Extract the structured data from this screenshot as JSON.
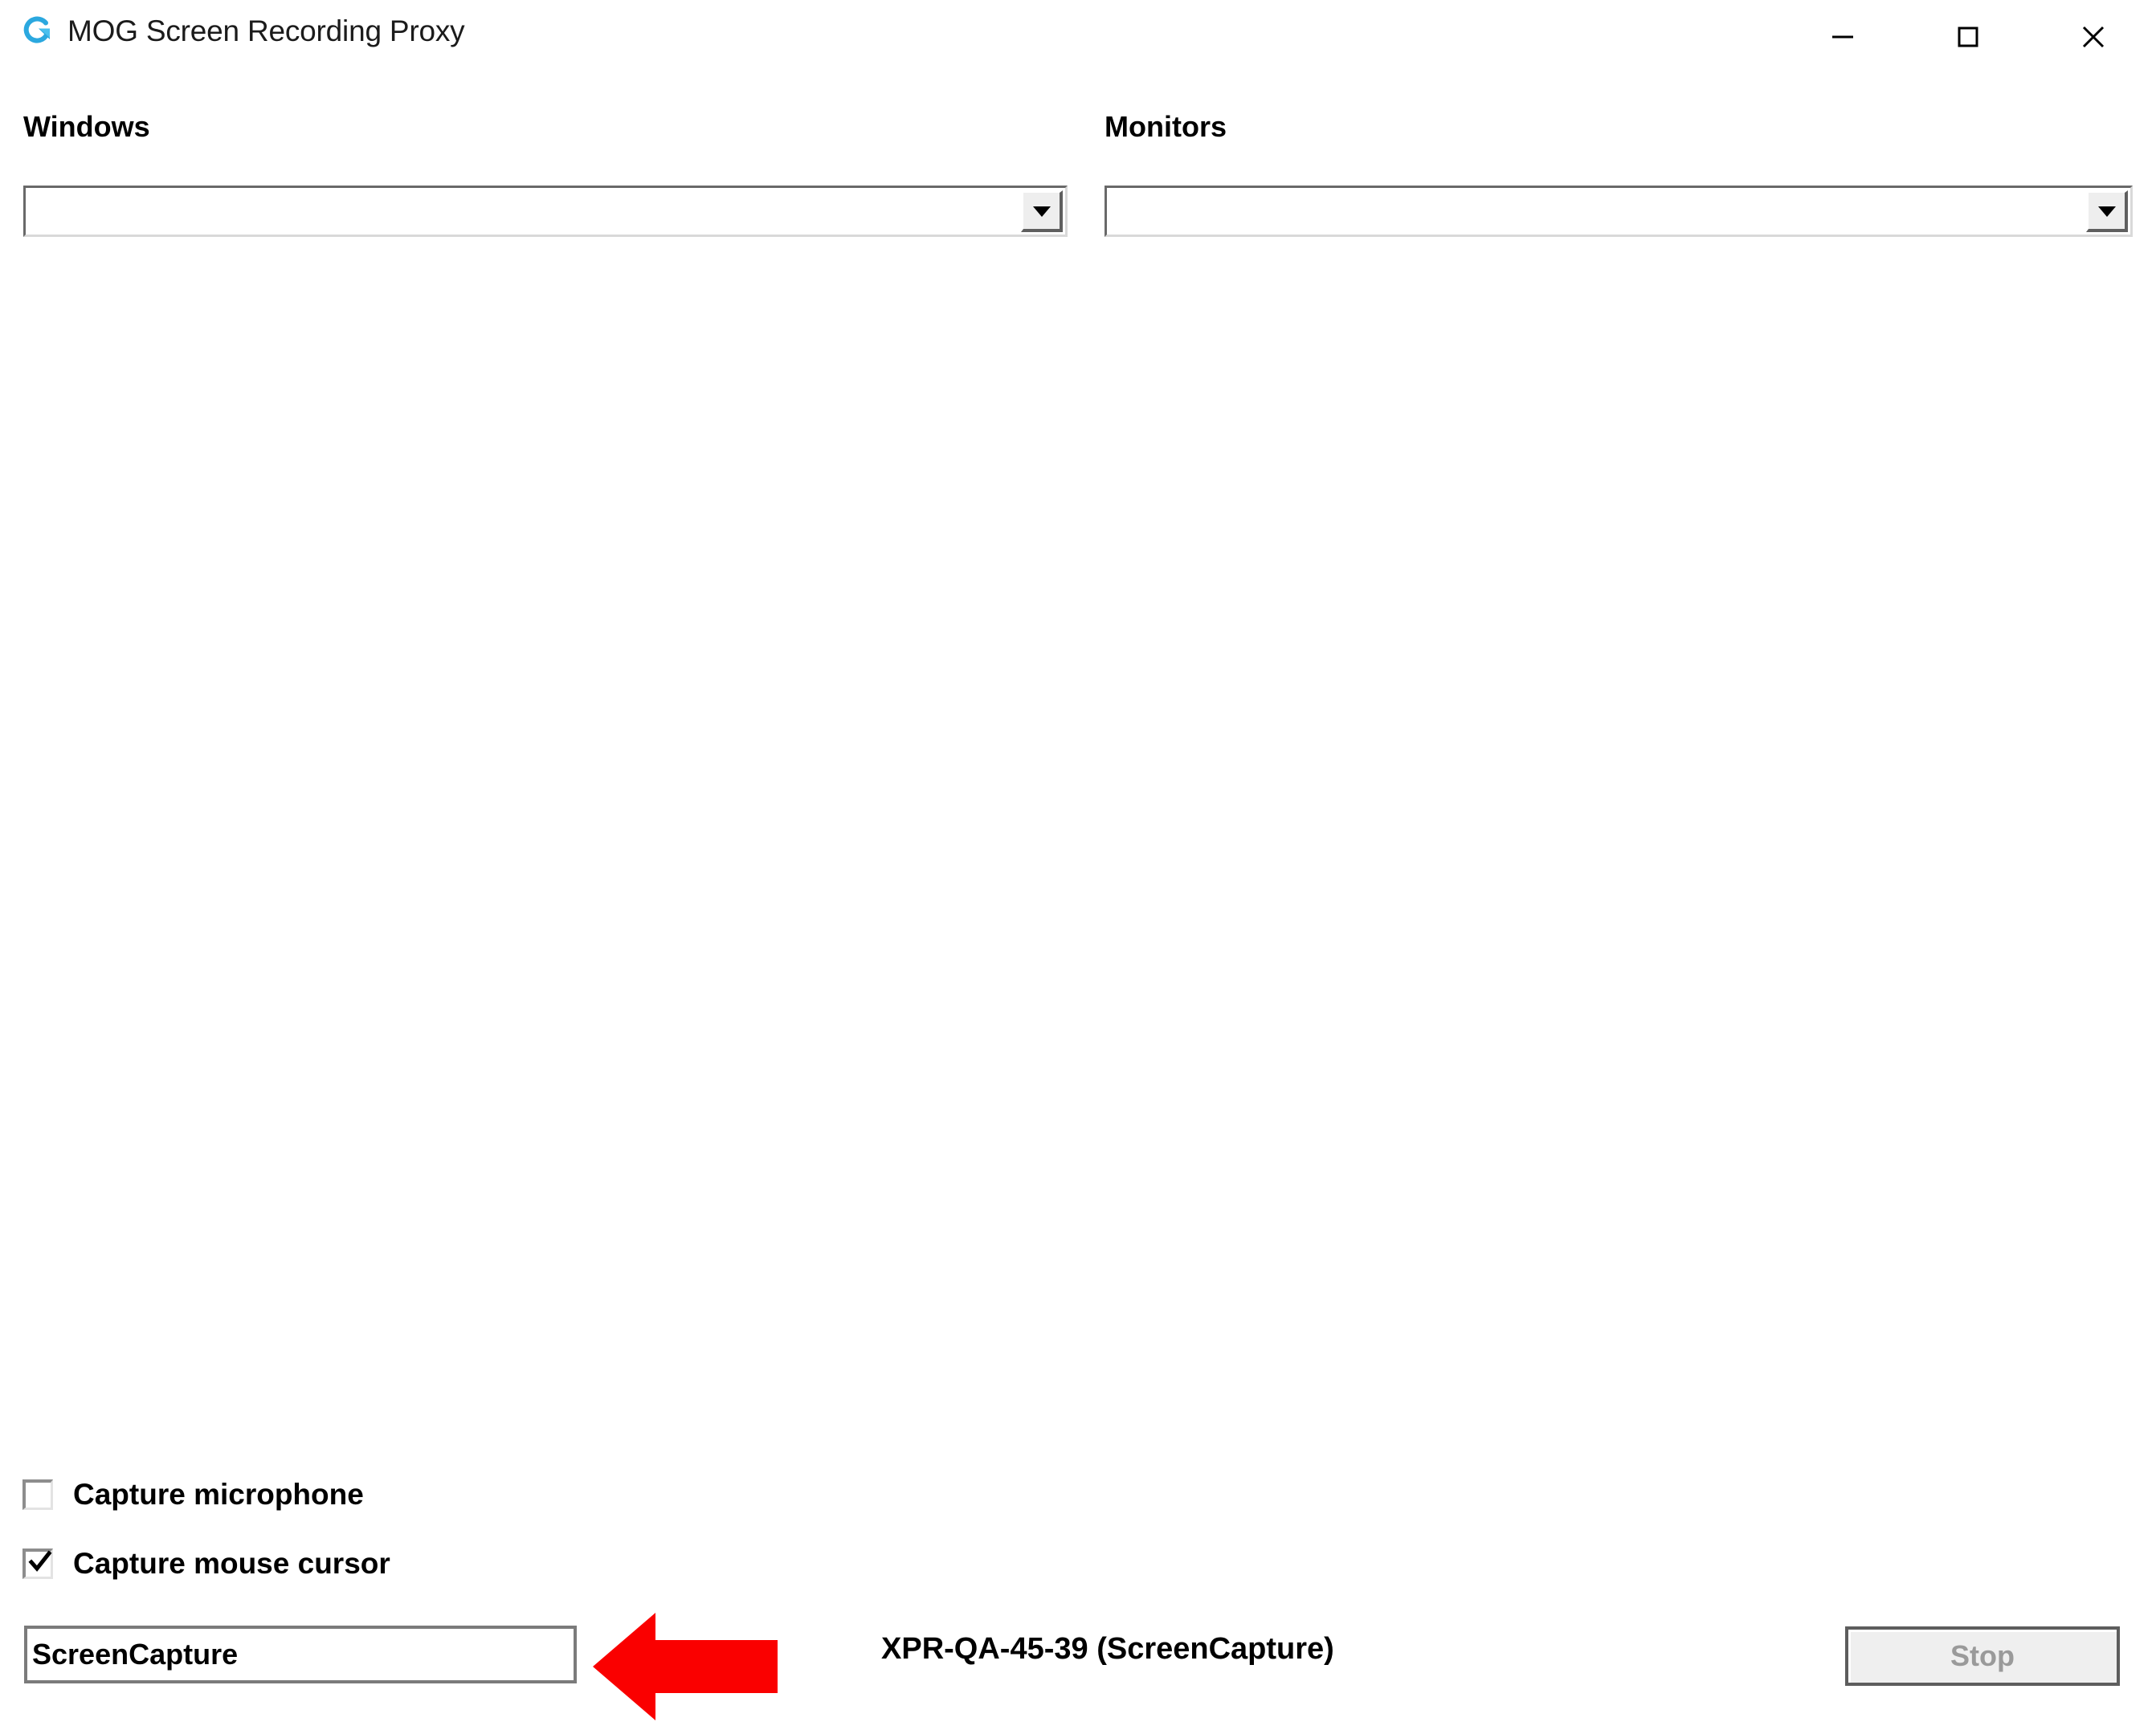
{
  "window": {
    "title": "MOG Screen Recording Proxy",
    "logo_icon": "mog-circular-arrow-logo",
    "logo_color": "#2BA8DF",
    "controls": {
      "minimize": "minimize-icon",
      "maximize": "maximize-icon",
      "close": "close-icon"
    }
  },
  "sources": {
    "windows": {
      "label": "Windows",
      "dropdown_value": "",
      "dropdown_icon": "chevron-down-icon"
    },
    "monitors": {
      "label": "Monitors",
      "dropdown_value": "",
      "dropdown_icon": "chevron-down-icon"
    }
  },
  "options": {
    "capture_microphone": {
      "label": "Capture microphone",
      "checked": false
    },
    "capture_mouse_cursor": {
      "label": "Capture mouse cursor",
      "checked": true,
      "check_icon": "checkmark-icon"
    }
  },
  "footer": {
    "name_input": {
      "value": "ScreenCapture",
      "placeholder": ""
    },
    "status_text": "XPR-QA-45-39 (ScreenCapture)",
    "stop_button": {
      "label": "Stop",
      "disabled": true,
      "text_color": "#9A9A9A"
    }
  },
  "annotation": {
    "arrow": {
      "icon": "left-arrow-annotation",
      "color": "#FA0000",
      "direction": "left"
    }
  }
}
